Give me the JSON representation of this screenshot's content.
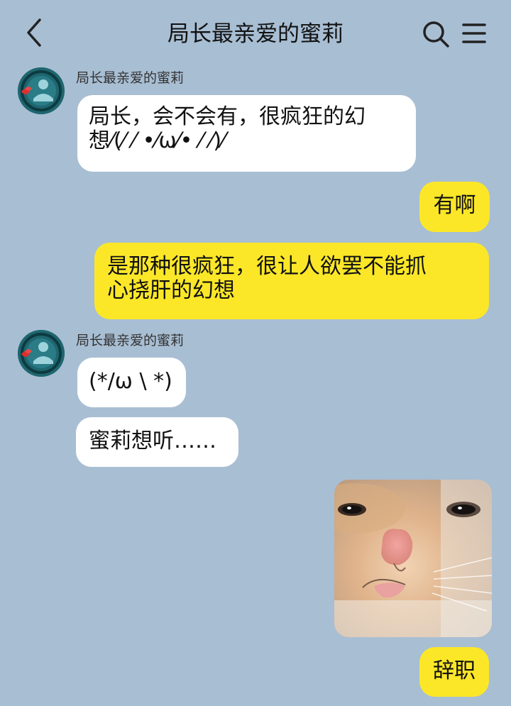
{
  "header": {
    "title": "局长最亲爱的蜜莉",
    "back_icon": "chevron-left-icon",
    "search_icon": "search-icon",
    "menu_icon": "menu-icon"
  },
  "messages": [
    {
      "side": "in",
      "sender": "局长最亲爱的蜜莉",
      "lines": [
        "局长，会不会有，很疯狂的幻",
        "想⁄(⁄ ⁄ •⁄ω⁄• ⁄ ⁄)⁄"
      ]
    },
    {
      "side": "out",
      "text": "有啊"
    },
    {
      "side": "out",
      "lines": [
        "是那种很疯狂，很让人欲罢不能抓",
        "心挠肝的幻想"
      ]
    },
    {
      "side": "in",
      "sender": "局长最亲爱的蜜莉",
      "text": "(*/ω \\ *)"
    },
    {
      "side": "in",
      "text": "蜜莉想听……"
    },
    {
      "side": "out",
      "type": "image",
      "image": "cat-face-sticker"
    },
    {
      "side": "out",
      "text": "辞职"
    }
  ],
  "colors": {
    "background": "#a8bed3",
    "incoming_bubble": "#ffffff",
    "outgoing_bubble": "#fbe728"
  }
}
